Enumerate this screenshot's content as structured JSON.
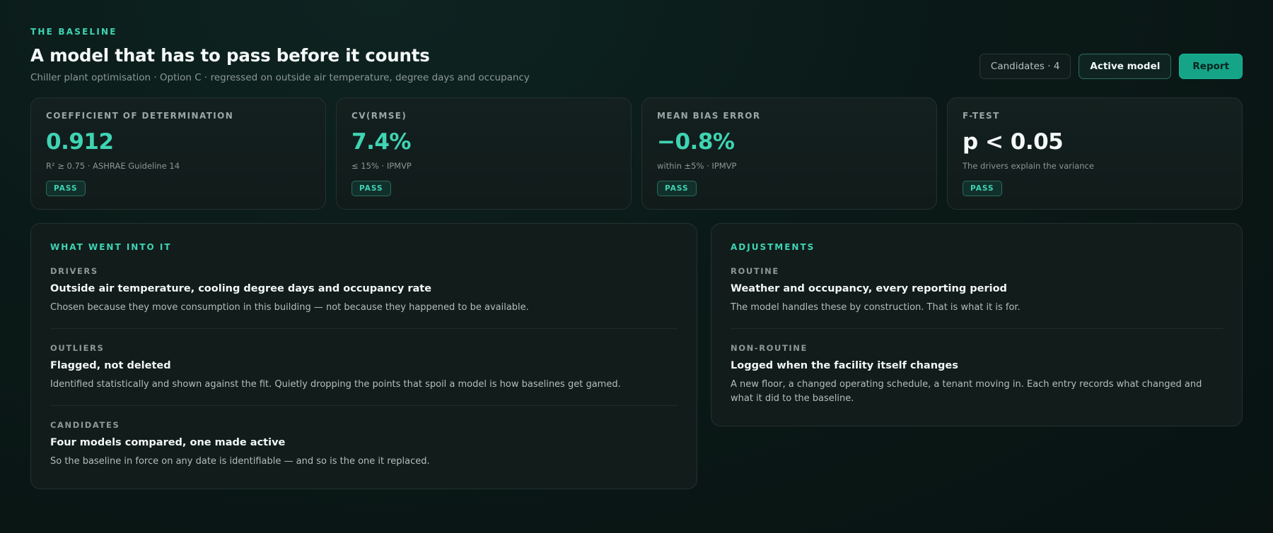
{
  "header": {
    "eyebrow": "THE BASELINE",
    "title": "A model that has to pass before it counts",
    "subtitle": "Chiller plant optimisation · Option C · regressed on outside air temperature, degree days and occupancy"
  },
  "actions": {
    "candidates_label": "Candidates · 4",
    "active_model_label": "Active model",
    "report_label": "Report"
  },
  "metrics": [
    {
      "label": "COEFFICIENT OF DETERMINATION",
      "value": "0.912",
      "note": "R² ≥ 0.75 · ASHRAE Guideline 14",
      "status": "PASS"
    },
    {
      "label": "CV(RMSE)",
      "value": "7.4%",
      "note": "≤ 15% · IPMVP",
      "status": "PASS"
    },
    {
      "label": "MEAN BIAS ERROR",
      "value": "−0.8%",
      "note": "within ±5% · IPMVP",
      "status": "PASS"
    },
    {
      "label": "F-TEST",
      "value": "p < 0.05",
      "note": "The drivers explain the variance",
      "status": "PASS"
    }
  ],
  "inputs_panel": {
    "heading": "WHAT WENT INTO IT",
    "items": [
      {
        "label": "DRIVERS",
        "title": "Outside air temperature, cooling degree days and occupancy rate",
        "desc": "Chosen because they move consumption in this building — not because they happened to be available."
      },
      {
        "label": "OUTLIERS",
        "title": "Flagged, not deleted",
        "desc": "Identified statistically and shown against the fit. Quietly dropping the points that spoil a model is how baselines get gamed."
      },
      {
        "label": "CANDIDATES",
        "title": "Four models compared, one made active",
        "desc": "So the baseline in force on any date is identifiable — and so is the one it replaced."
      }
    ]
  },
  "adjustments_panel": {
    "heading": "ADJUSTMENTS",
    "items": [
      {
        "label": "ROUTINE",
        "title": "Weather and occupancy, every reporting period",
        "desc": "The model handles these by construction. That is what it is for."
      },
      {
        "label": "NON-ROUTINE",
        "title": "Logged when the facility itself changes",
        "desc": "A new floor, a changed operating schedule, a tenant moving in. Each entry records what changed and what it did to the baseline."
      }
    ]
  },
  "colors": {
    "accent": "#3fd4b3",
    "primary_button": "#16a488",
    "background": "#0a1917"
  }
}
